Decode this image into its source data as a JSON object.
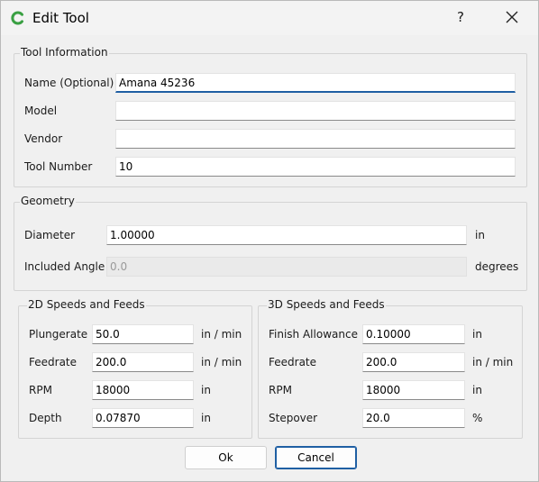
{
  "window": {
    "title": "Edit Tool",
    "help_label": "?"
  },
  "tool_info": {
    "title": "Tool Information",
    "name_label": "Name (Optional)",
    "name_value": "Amana 45236",
    "model_label": "Model",
    "model_value": "",
    "vendor_label": "Vendor",
    "vendor_value": "",
    "tool_number_label": "Tool Number",
    "tool_number_value": "10"
  },
  "geometry": {
    "title": "Geometry",
    "diameter_label": "Diameter",
    "diameter_value": "1.00000",
    "diameter_unit": "in",
    "angle_label": "Included Angle",
    "angle_value": "0.0",
    "angle_unit": "degrees"
  },
  "speeds_2d": {
    "title": "2D Speeds and Feeds",
    "plungerate_label": "Plungerate",
    "plungerate_value": "50.0",
    "plungerate_unit": "in / min",
    "feedrate_label": "Feedrate",
    "feedrate_value": "200.0",
    "feedrate_unit": "in / min",
    "rpm_label": "RPM",
    "rpm_value": "18000",
    "rpm_unit": "in",
    "depth_label": "Depth",
    "depth_value": "0.07870",
    "depth_unit": "in"
  },
  "speeds_3d": {
    "title": "3D Speeds and Feeds",
    "finish_label": "Finish Allowance",
    "finish_value": "0.10000",
    "finish_unit": "in",
    "feedrate_label": "Feedrate",
    "feedrate_value": "200.0",
    "feedrate_unit": "in / min",
    "rpm_label": "RPM",
    "rpm_value": "18000",
    "rpm_unit": "in",
    "stepover_label": "Stepover",
    "stepover_value": "20.0",
    "stepover_unit": "%"
  },
  "buttons": {
    "ok": "Ok",
    "cancel": "Cancel"
  },
  "colors": {
    "accent": "#1f5fa3",
    "app_icon": "#3aa043"
  }
}
